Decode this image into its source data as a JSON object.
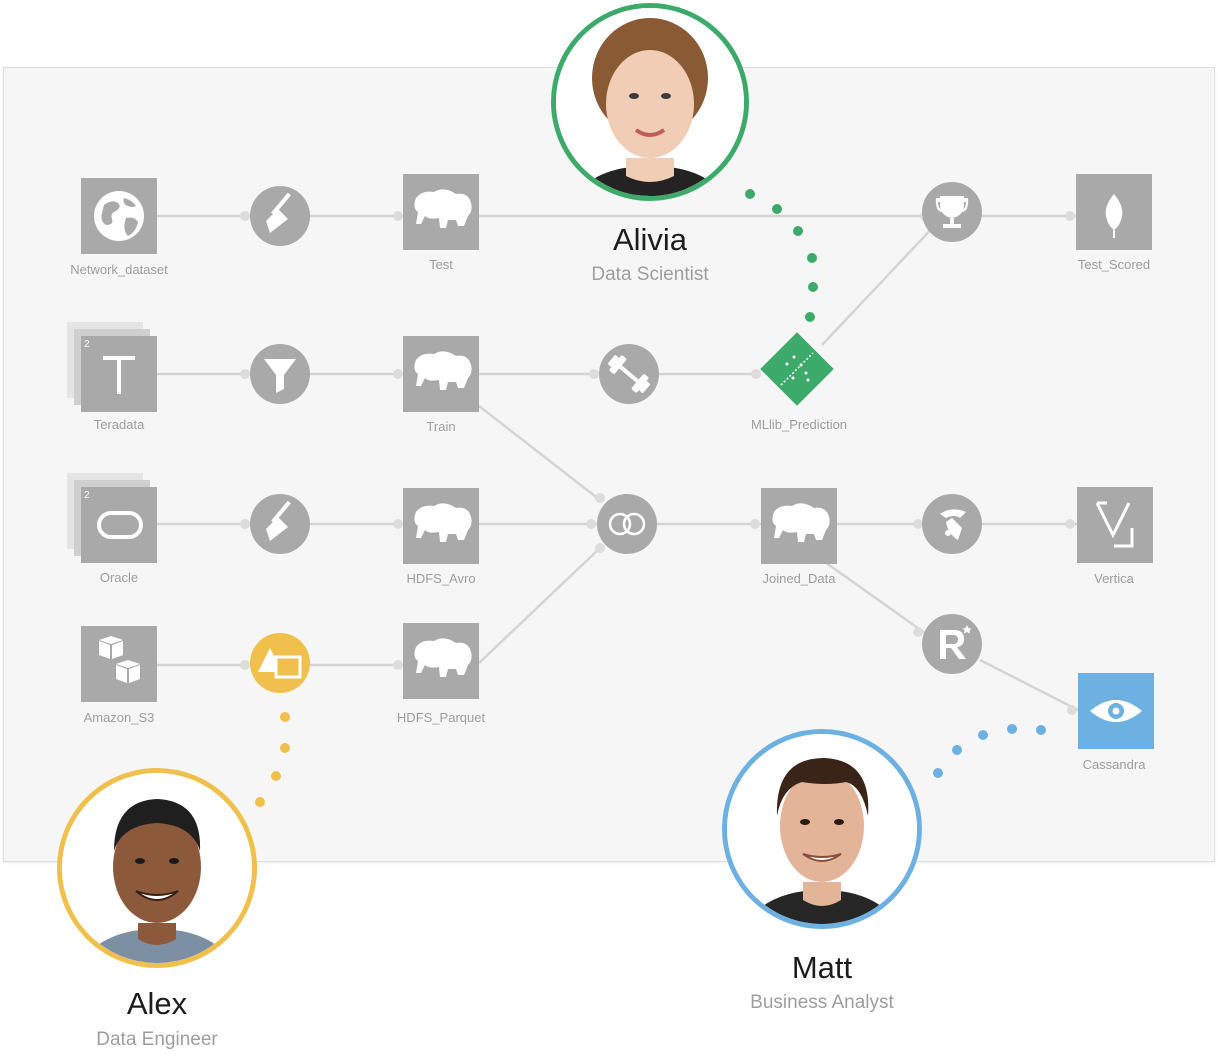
{
  "nodes": {
    "network_dataset": "Network_dataset",
    "test": "Test",
    "test_scored": "Test_Scored",
    "teradata": "Teradata",
    "train": "Train",
    "mllib_prediction": "MLlib_Prediction",
    "oracle": "Oracle",
    "hdfs_avro": "HDFS_Avro",
    "joined_data": "Joined_Data",
    "vertica": "Vertica",
    "amazon_s3": "Amazon_S3",
    "hdfs_parquet": "HDFS_Parquet",
    "cassandra": "Cassandra"
  },
  "stack_badges": {
    "teradata": "2",
    "oracle": "2"
  },
  "people": {
    "alivia": {
      "name": "Alivia",
      "role": "Data Scientist",
      "ring_color": "#3cab6a"
    },
    "alex": {
      "name": "Alex",
      "role": "Data Engineer",
      "ring_color": "#f1bf4b"
    },
    "matt": {
      "name": "Matt",
      "role": "Business Analyst",
      "ring_color": "#6db0e2"
    }
  },
  "icons": {
    "network_dataset": "globe-icon",
    "test": "hadoop-elephant-icon",
    "test_scored": "mongodb-leaf-icon",
    "teradata": "teradata-t-icon",
    "oracle": "oracle-icon",
    "amazon_s3": "s3-cubes-icon",
    "cassandra": "cassandra-eye-icon",
    "vertica": "vertica-icon",
    "recipe_clean_1": "broom-icon",
    "recipe_clean_2": "broom-icon",
    "recipe_filter": "funnel-icon",
    "recipe_train": "dumbbell-icon",
    "recipe_evaluate": "trophy-icon",
    "recipe_join": "join-icon",
    "recipe_python": "python-icon",
    "recipe_r": "r-icon",
    "recipe_sync": "sync-icon"
  },
  "colors": {
    "node_gray": "#a9a9a9",
    "edge": "#d4d4d4",
    "model_green": "#3cab6a",
    "recipe_yellow": "#f1bf4b",
    "cassandra_blue": "#6db0e2"
  }
}
